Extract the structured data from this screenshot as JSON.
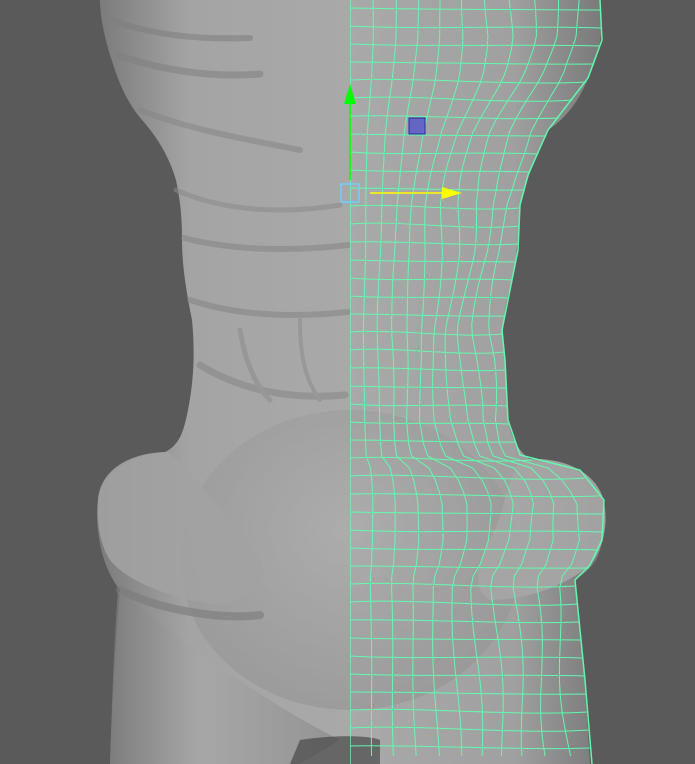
{
  "viewport": {
    "background": "#5a5a5a",
    "model_shade": "#9a9a9a",
    "wireframe_color": "#5fffb0",
    "icons": {
      "move_x_axis": "arrow-right-yellow",
      "move_y_axis": "arrow-up-green",
      "plane_handle_xy": "square-blue",
      "center_handle": "square-cyan"
    },
    "axis_colors": {
      "x": "#ffff00",
      "y": "#00ff00",
      "xy_plane": "#4a4ad0",
      "center": "#6fd0ff"
    }
  }
}
